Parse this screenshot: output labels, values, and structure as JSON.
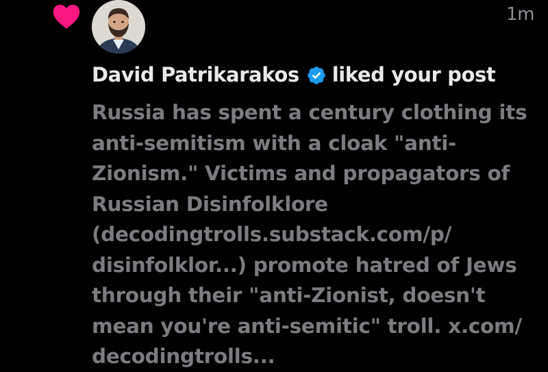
{
  "notification": {
    "type_icon": "heart-icon",
    "timestamp": "1m",
    "user": {
      "name": "David Patrikarakos",
      "verified": true,
      "avatar": "avatar-photo"
    },
    "action": "liked your post",
    "post_lines": [
      "Russia has spent a century clothing its",
      "anti-semitism with a cloak \"anti-",
      "Zionism.\" Victims and propagators of",
      "Russian Disinfolklore",
      "(decodingtrolls.substack.com/p/",
      "disinfolklor...) promote hatred of Jews",
      "through their \"anti-Zionist, doesn't",
      "mean you're anti-semitic\" troll. x.com/",
      "decodingtrolls..."
    ]
  },
  "colors": {
    "background": "#000000",
    "heart": "#f91880",
    "verified": "#1d9bf0",
    "primary_text": "#e7e9ea",
    "secondary_text": "#7a7c80"
  }
}
